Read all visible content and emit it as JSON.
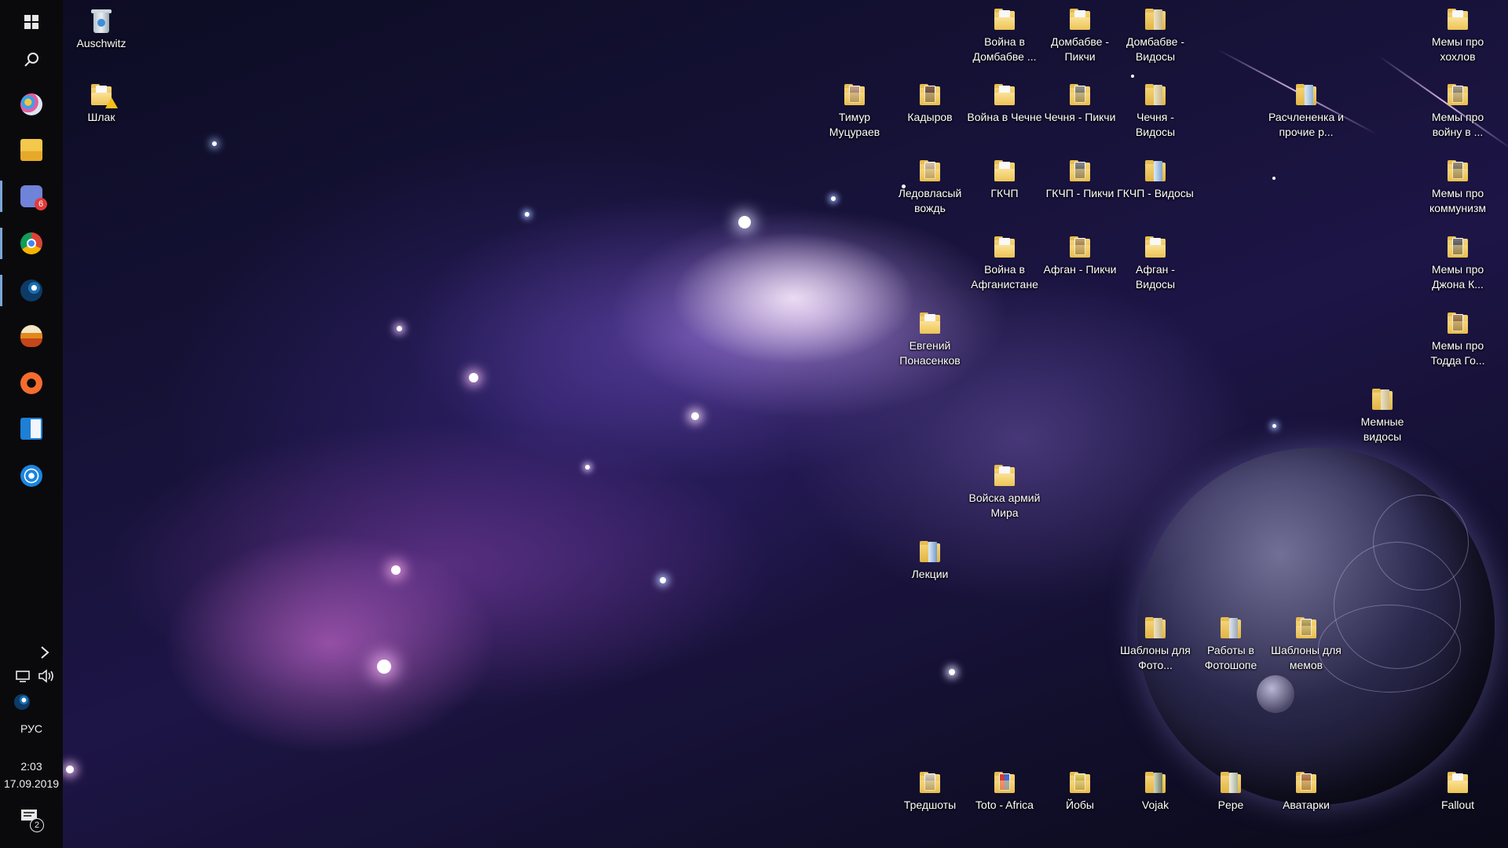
{
  "taskbar": {
    "items": [
      {
        "name": "start-button",
        "icon": "windows-logo-icon"
      },
      {
        "name": "search-button",
        "icon": "search-icon"
      },
      {
        "name": "paint-app",
        "icon": "paint-icon"
      },
      {
        "name": "file-explorer",
        "icon": "folder-icon"
      },
      {
        "name": "discord-app",
        "icon": "discord-icon",
        "badge": "6",
        "active": true
      },
      {
        "name": "chrome-app",
        "icon": "chrome-icon",
        "active": true
      },
      {
        "name": "steam-app",
        "icon": "steam-icon",
        "active": true
      },
      {
        "name": "paradox-launcher",
        "icon": "launcher-icon"
      },
      {
        "name": "origin-app",
        "icon": "origin-icon"
      },
      {
        "name": "windows-media-app",
        "icon": "media-icon"
      },
      {
        "name": "uplay-app",
        "icon": "uplay-icon"
      }
    ],
    "tray": {
      "language": "РУС",
      "time": "2:03",
      "date": "17.09.2019",
      "notifications_badge": "2"
    },
    "colors": {
      "background": "#0a0a0c",
      "active_indicator": "#7ba6d8",
      "badge": "#e13b3b"
    }
  },
  "desktop": {
    "icons": [
      {
        "label": "Auschwitz",
        "type": "recycle-bin"
      },
      {
        "label": "Шлак",
        "type": "folder-warning"
      },
      {
        "label": "Война в Домбабве ...",
        "type": "folder"
      },
      {
        "label": "Домбабве - Пикчи",
        "type": "folder"
      },
      {
        "label": "Домбабве - Видосы",
        "type": "folder-door"
      },
      {
        "label": "Мемы про хохлов",
        "type": "folder"
      },
      {
        "label": "Тимур Муцураев",
        "type": "folder-thumb"
      },
      {
        "label": "Кадыров",
        "type": "folder-thumb"
      },
      {
        "label": "Война в Чечне",
        "type": "folder"
      },
      {
        "label": "Чечня - Пикчи",
        "type": "folder-thumb"
      },
      {
        "label": "Чечня - Видосы",
        "type": "folder-door"
      },
      {
        "label": "Расчлененка и прочие р...",
        "type": "folder-door"
      },
      {
        "label": "Мемы про войну в ...",
        "type": "folder-thumb"
      },
      {
        "label": "Ледовласый вождь",
        "type": "folder-thumb"
      },
      {
        "label": "ГКЧП",
        "type": "folder"
      },
      {
        "label": "ГКЧП - Пикчи",
        "type": "folder-thumb"
      },
      {
        "label": "ГКЧП - Видосы",
        "type": "folder-door"
      },
      {
        "label": "Мемы про коммунизм",
        "type": "folder-thumb"
      },
      {
        "label": "Война в Афганистане",
        "type": "folder"
      },
      {
        "label": "Афган - Пикчи",
        "type": "folder-thumb"
      },
      {
        "label": "Афган - Видосы",
        "type": "folder"
      },
      {
        "label": "Мемы про Джона К...",
        "type": "folder-thumb"
      },
      {
        "label": "Евгений Понасенков",
        "type": "folder"
      },
      {
        "label": "Мемы про Тодда Го...",
        "type": "folder-thumb"
      },
      {
        "label": "Мемные видосы",
        "type": "folder-door"
      },
      {
        "label": "Войска армий Мира",
        "type": "folder"
      },
      {
        "label": "Лекции",
        "type": "folder-door"
      },
      {
        "label": "Шаблоны для Фото...",
        "type": "folder-door"
      },
      {
        "label": "Работы в Фотошопе",
        "type": "folder-door"
      },
      {
        "label": "Шаблоны для мемов",
        "type": "folder-thumb"
      },
      {
        "label": "Тредшоты",
        "type": "folder-thumb"
      },
      {
        "label": "Toto - Africa",
        "type": "folder-thumb"
      },
      {
        "label": "Йобы",
        "type": "folder-thumb"
      },
      {
        "label": "Vojak",
        "type": "folder-door"
      },
      {
        "label": "Pepe",
        "type": "folder-door"
      },
      {
        "label": "Аватарки",
        "type": "folder-thumb"
      },
      {
        "label": "Fallout",
        "type": "folder"
      }
    ]
  }
}
